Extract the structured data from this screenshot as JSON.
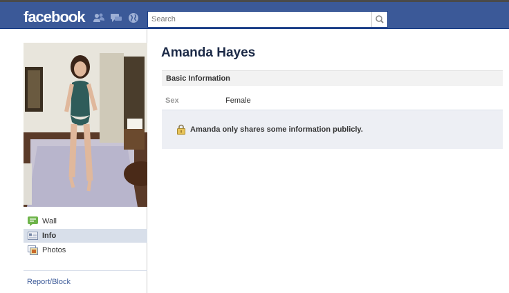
{
  "header": {
    "logo": "facebook",
    "search_placeholder": "Search"
  },
  "sidebar": {
    "items": [
      {
        "label": "Wall",
        "icon": "wall-icon",
        "active": false
      },
      {
        "label": "Info",
        "icon": "info-icon",
        "active": true
      },
      {
        "label": "Photos",
        "icon": "photos-icon",
        "active": false
      }
    ],
    "report_link": "Report/Block"
  },
  "profile": {
    "name": "Amanda Hayes",
    "section_title": "Basic Information",
    "fields": [
      {
        "label": "Sex",
        "value": "Female"
      }
    ],
    "privacy_notice": "Amanda only shares some information publicly."
  },
  "colors": {
    "brand_blue": "#3b5998",
    "nav_active": "#d8dfea",
    "notice_bg": "#edeff4"
  }
}
